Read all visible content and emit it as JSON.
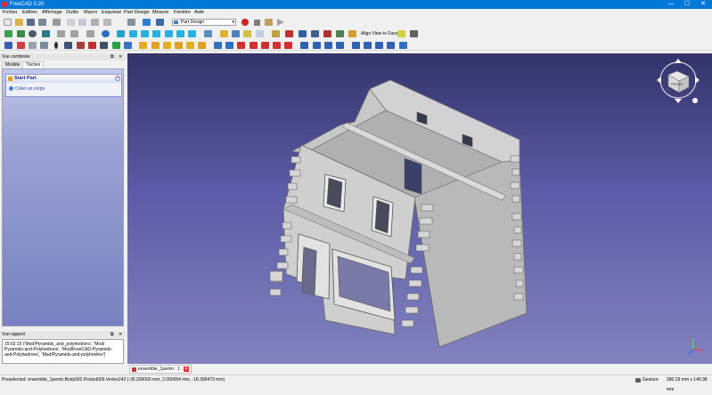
{
  "window": {
    "title": "FreeCAD 0.20",
    "minimize": "—",
    "maximize": "☐",
    "close": "✕"
  },
  "menu": [
    "Fichier",
    "Edition",
    "Affichage",
    "Outils",
    "Macro",
    "Esquisse",
    "Part Design",
    "Mesure",
    "Fenêtre",
    "Aide"
  ],
  "toolbar": {
    "workbench": "Part Design",
    "align_view_to_face": "Align View to Face"
  },
  "combo_view": {
    "title": "Vue combinée",
    "tabs": [
      "Modèle",
      "Tâches"
    ],
    "active_tab": "Tâches",
    "task_panel": {
      "title": "Start Part",
      "item": "Créer un corps"
    }
  },
  "report_view": {
    "title": "Vue rapport",
    "lines": [
      "15:02:15  ('Mod/Pyramids_and_polyhedrons', 'Mod/",
      "Pyramids-and-Polyhedrons', 'Mod/FreeCAD-Pyramids-",
      "and-Polyhedrons', 'Mod/Pyramids-and-polyhedron')"
    ]
  },
  "document_tab": {
    "label": "ensemble_1perrin : 1",
    "close": "✕"
  },
  "view_cube": {
    "face": "FRONT"
  },
  "status": {
    "message": "Preselected: ensemble_1perrin.Body002.Pocket009.Vertex242 (-35.300000 mm, 2.000054 mm, -18.395473 mm)",
    "navigation": "Gesture",
    "dimensions": "280.29 mm x 149.38 mm"
  },
  "colors": {
    "title_bar": "#0078d7",
    "viewport_top": "#33336a",
    "viewport_bottom": "#8282bf",
    "model": "#c9c9c9"
  }
}
